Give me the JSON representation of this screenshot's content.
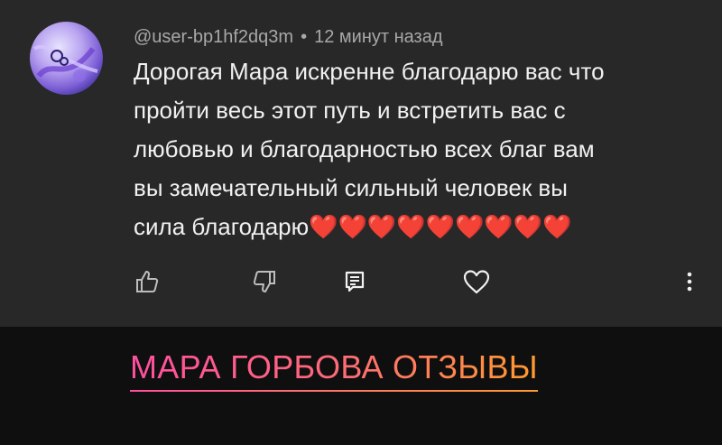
{
  "comment": {
    "author": "@user-bp1hf2dq3m",
    "separator": "•",
    "timestamp": "12 минут назад",
    "text": "Дорогая Мара искренне благодарю вас что\nпройти весь этот путь и встретить вас с\nлюбовью и благодарностью всех благ вам\nвы замечательный сильный человек вы\nсила благодарю❤️❤️❤️❤️❤️❤️❤️❤️❤️"
  },
  "actions": {
    "like_icon": "thumbs-up-outline",
    "dislike_icon": "thumbs-down-outline",
    "reply_icon": "comment-reply",
    "heart_icon": "heart-outline",
    "more_icon": "vertical-ellipsis"
  },
  "banner": {
    "link_text": "МАРА ГОРБОВА ОТЗЫВЫ",
    "gradient_start": "#ff4fa0",
    "gradient_end": "#ff9a2e"
  },
  "colors": {
    "card_bg": "#282828",
    "page_bg": "#0f0f0f",
    "text_primary": "#f1f1f1",
    "text_secondary": "#a8a8a8"
  }
}
